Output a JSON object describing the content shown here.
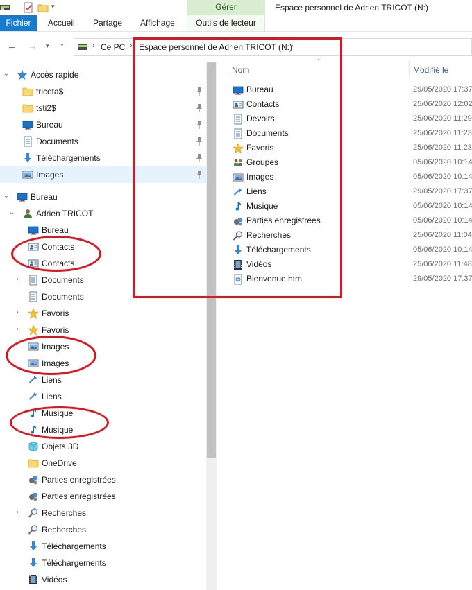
{
  "window": {
    "title": "Espace personnel de Adrien TRICOT (N:)",
    "contextual_tab": "Gérer"
  },
  "ribbon": {
    "tabs": [
      "Fichier",
      "Accueil",
      "Partage",
      "Affichage",
      "Outils de lecteur"
    ]
  },
  "address": {
    "crumbs": [
      "Ce PC",
      "Espace personnel de Adrien TRICOT (N:)"
    ]
  },
  "nav": {
    "quick_access": "Accès rapide",
    "quick_items": [
      {
        "label": "tricota$",
        "icon": "folder-yellow-icon"
      },
      {
        "label": "tsti2$",
        "icon": "folder-yellow-icon"
      },
      {
        "label": "Bureau",
        "icon": "desktop-icon"
      },
      {
        "label": "Documents",
        "icon": "documents-icon"
      },
      {
        "label": "Téléchargements",
        "icon": "downloads-icon"
      },
      {
        "label": "Images",
        "icon": "pictures-icon"
      }
    ],
    "desktop": "Bureau",
    "user": "Adrien TRICOT",
    "user_items": [
      {
        "label": "Bureau",
        "icon": "desktop-icon",
        "expandable": false
      },
      {
        "label": "Contacts",
        "icon": "contacts-icon",
        "expandable": false
      },
      {
        "label": "Contacts",
        "icon": "contacts-icon",
        "expandable": false
      },
      {
        "label": "Documents",
        "icon": "documents-icon",
        "expandable": true
      },
      {
        "label": "Documents",
        "icon": "documents-icon",
        "expandable": false
      },
      {
        "label": "Favoris",
        "icon": "favorites-icon",
        "expandable": true
      },
      {
        "label": "Favoris",
        "icon": "favorites-icon",
        "expandable": true
      },
      {
        "label": "Images",
        "icon": "pictures-icon",
        "expandable": false
      },
      {
        "label": "Images",
        "icon": "pictures-icon",
        "expandable": false
      },
      {
        "label": "Liens",
        "icon": "links-icon",
        "expandable": false
      },
      {
        "label": "Liens",
        "icon": "links-icon",
        "expandable": false
      },
      {
        "label": "Musique",
        "icon": "music-icon",
        "expandable": false
      },
      {
        "label": "Musique",
        "icon": "music-icon",
        "expandable": false
      },
      {
        "label": "Objets 3D",
        "icon": "objects3d-icon",
        "expandable": false
      },
      {
        "label": "OneDrive",
        "icon": "folder-yellow-icon",
        "expandable": false
      },
      {
        "label": "Parties enregistrées",
        "icon": "saved-games-icon",
        "expandable": false
      },
      {
        "label": "Parties enregistrées",
        "icon": "saved-games-icon",
        "expandable": false
      },
      {
        "label": "Recherches",
        "icon": "search-icon",
        "expandable": true
      },
      {
        "label": "Recherches",
        "icon": "search-icon",
        "expandable": false
      },
      {
        "label": "Téléchargements",
        "icon": "downloads-icon",
        "expandable": false
      },
      {
        "label": "Téléchargements",
        "icon": "downloads-icon",
        "expandable": false
      },
      {
        "label": "Vidéos",
        "icon": "videos-icon",
        "expandable": false
      }
    ]
  },
  "content": {
    "columns": {
      "name": "Nom",
      "modified": "Modifié le"
    },
    "files": [
      {
        "name": "Bureau",
        "icon": "desktop-icon",
        "modified": "29/05/2020 17:37"
      },
      {
        "name": "Contacts",
        "icon": "contacts-icon",
        "modified": "25/06/2020 12:02"
      },
      {
        "name": "Devoirs",
        "icon": "documents-icon",
        "modified": "25/06/2020 11:29"
      },
      {
        "name": "Documents",
        "icon": "documents-icon",
        "modified": "25/06/2020 11:23"
      },
      {
        "name": "Favoris",
        "icon": "favorites-icon",
        "modified": "25/06/2020 11:23"
      },
      {
        "name": "Groupes",
        "icon": "groups-icon",
        "modified": "05/06/2020 10:14"
      },
      {
        "name": "Images",
        "icon": "pictures-icon",
        "modified": "05/06/2020 10:14"
      },
      {
        "name": "Liens",
        "icon": "links-icon",
        "modified": "29/05/2020 17:37"
      },
      {
        "name": "Musique",
        "icon": "music-icon",
        "modified": "05/06/2020 10:14"
      },
      {
        "name": "Parties enregistrées",
        "icon": "saved-games-icon",
        "modified": "05/06/2020 10:14"
      },
      {
        "name": "Recherches",
        "icon": "search-icon",
        "modified": "25/06/2020 11:04"
      },
      {
        "name": "Téléchargements",
        "icon": "downloads-icon",
        "modified": "05/06/2020 10:14"
      },
      {
        "name": "Vidéos",
        "icon": "videos-icon",
        "modified": "25/06/2020 11:48"
      },
      {
        "name": "Bienvenue.htm",
        "icon": "html-file-icon",
        "modified": "29/05/2020 17:37"
      }
    ]
  },
  "colors": {
    "accent": "#1979ca",
    "selection": "#e5f3ff",
    "manage_tab": "#d9eed1",
    "annotation": "#e0141e"
  }
}
